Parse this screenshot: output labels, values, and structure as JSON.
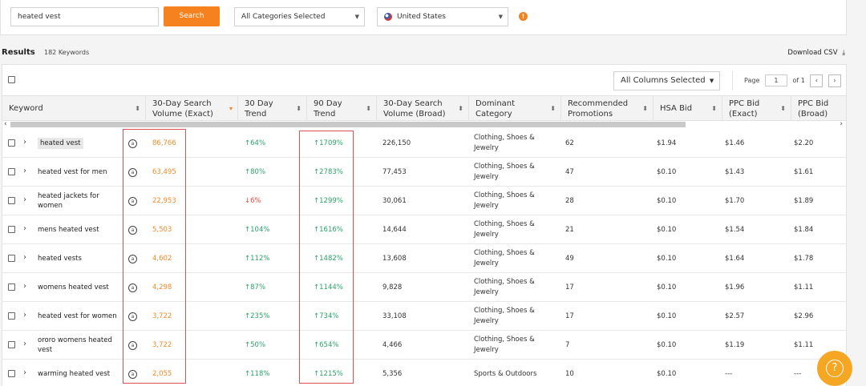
{
  "search": {
    "value": "heated vest",
    "button": "Search"
  },
  "category_select": {
    "value": "All Categories Selected"
  },
  "country_select": {
    "value": "United States"
  },
  "results": {
    "label": "Results",
    "count": "182 Keywords",
    "download": "Download CSV"
  },
  "columns_select": {
    "value": "All Columns Selected"
  },
  "pager": {
    "label": "Page",
    "current": "1",
    "of": "of 1",
    "prev": "‹",
    "next": "›"
  },
  "headers": [
    {
      "line1": "Keyword",
      "line2": ""
    },
    {
      "line1": "30-Day Search",
      "line2": "Volume (Exact)"
    },
    {
      "line1": "30 Day",
      "line2": "Trend"
    },
    {
      "line1": "90 Day",
      "line2": "Trend"
    },
    {
      "line1": "30-Day Search",
      "line2": "Volume (Broad)"
    },
    {
      "line1": "Dominant",
      "line2": "Category"
    },
    {
      "line1": "Recommended",
      "line2": "Promotions"
    },
    {
      "line1": "HSA Bid",
      "line2": ""
    },
    {
      "line1": "PPC Bid",
      "line2": "(Exact)"
    },
    {
      "line1": "PPC Bid",
      "line2": "(Broad)"
    }
  ],
  "rows": [
    {
      "keyword": "heated vest",
      "vol": "86,766",
      "t30": "64%",
      "t30dir": "up",
      "t90": "1709%",
      "broad": "226,150",
      "cat": "Clothing, Shoes & Jewelry",
      "promo": "62",
      "hsa": "$1.94",
      "ppce": "$1.46",
      "ppcb": "$2.20"
    },
    {
      "keyword": "heated vest for men",
      "vol": "63,495",
      "t30": "80%",
      "t30dir": "up",
      "t90": "2783%",
      "broad": "77,453",
      "cat": "Clothing, Shoes & Jewelry",
      "promo": "47",
      "hsa": "$0.10",
      "ppce": "$1.43",
      "ppcb": "$1.61"
    },
    {
      "keyword": "heated jackets for women",
      "vol": "22,953",
      "t30": "6%",
      "t30dir": "down",
      "t90": "1299%",
      "broad": "30,061",
      "cat": "Clothing, Shoes & Jewelry",
      "promo": "28",
      "hsa": "$0.10",
      "ppce": "$1.70",
      "ppcb": "$1.89"
    },
    {
      "keyword": "mens heated vest",
      "vol": "5,503",
      "t30": "104%",
      "t30dir": "up",
      "t90": "1616%",
      "broad": "14,644",
      "cat": "Clothing, Shoes & Jewelry",
      "promo": "21",
      "hsa": "$0.10",
      "ppce": "$1.54",
      "ppcb": "$1.84"
    },
    {
      "keyword": "heated vests",
      "vol": "4,602",
      "t30": "112%",
      "t30dir": "up",
      "t90": "1482%",
      "broad": "13,608",
      "cat": "Clothing, Shoes & Jewelry",
      "promo": "49",
      "hsa": "$0.10",
      "ppce": "$1.64",
      "ppcb": "$1.78"
    },
    {
      "keyword": "womens heated vest",
      "vol": "4,298",
      "t30": "87%",
      "t30dir": "up",
      "t90": "1144%",
      "broad": "9,828",
      "cat": "Clothing, Shoes & Jewelry",
      "promo": "17",
      "hsa": "$0.10",
      "ppce": "$1.96",
      "ppcb": "$1.11"
    },
    {
      "keyword": "heated vest for women",
      "vol": "3,722",
      "t30": "235%",
      "t30dir": "up",
      "t90": "734%",
      "broad": "33,108",
      "cat": "Clothing, Shoes & Jewelry",
      "promo": "17",
      "hsa": "$0.10",
      "ppce": "$2.57",
      "ppcb": "$2.96"
    },
    {
      "keyword": "ororo womens heated vest",
      "vol": "3,722",
      "t30": "50%",
      "t30dir": "up",
      "t90": "654%",
      "broad": "4,466",
      "cat": "Clothing, Shoes & Jewelry",
      "promo": "7",
      "hsa": "$0.10",
      "ppce": "$1.19",
      "ppcb": "$1.11"
    },
    {
      "keyword": "warming heated vest",
      "vol": "2,055",
      "t30": "118%",
      "t30dir": "up",
      "t90": "1215%",
      "broad": "5,356",
      "cat": "Sports & Outdoors",
      "promo": "10",
      "hsa": "$0.10",
      "ppce": "---",
      "ppcb": "---"
    }
  ],
  "colors": {
    "accent": "#f5821f",
    "trend_up": "#2aa36a",
    "trend_down": "#e24a3b",
    "highlight_box": "#e05050"
  },
  "icons": {
    "help": "question-circle-icon",
    "info": "info-icon",
    "download": "download-icon"
  }
}
